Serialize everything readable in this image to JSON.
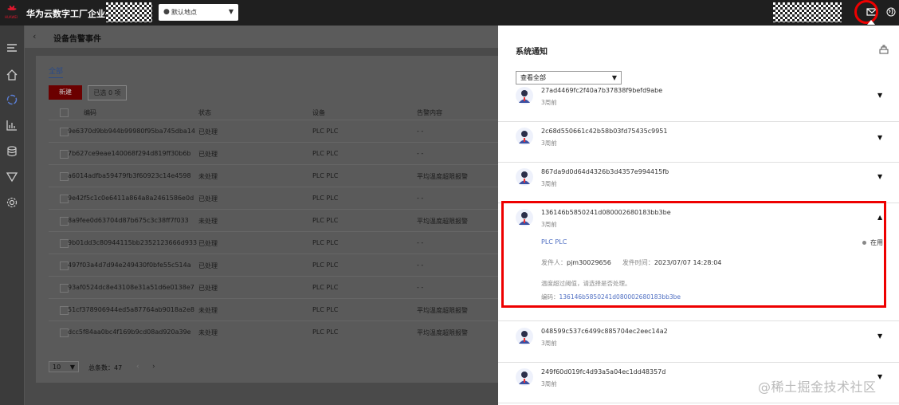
{
  "app": {
    "brand_word": "HUAWEI",
    "title": "华为云数字工厂企业平台",
    "location": "默认地点"
  },
  "colors": {
    "accent": "#4e6ec2",
    "brand": "#e4182f",
    "highlight": "#e00000"
  },
  "icons": {
    "sidebar": [
      "menu-icon",
      "home-icon",
      "refresh-cycle-icon",
      "bar-chart-icon",
      "database-icon",
      "funnel-icon",
      "gear-icon"
    ],
    "topbar": [
      "mail-icon",
      "globe-icon"
    ]
  },
  "page": {
    "back_label": "‹",
    "title": "设备告警事件",
    "tab_all": "全部",
    "new_button": "新建",
    "selected_label": "已选 0 项",
    "columns": [
      "编码",
      "状态",
      "设备",
      "告警内容"
    ],
    "rows": [
      {
        "code": "9e6370d9bb944b99980f95ba745dba14",
        "status": "已处理",
        "device": "PLC PLC",
        "content": "- -"
      },
      {
        "code": "7b627ce9eae140068f294d819ff30b6b",
        "status": "已处理",
        "device": "PLC PLC",
        "content": "- -"
      },
      {
        "code": "a6014adfba59479fb3f60923c14e4598",
        "status": "未处理",
        "device": "PLC PLC",
        "content": "平均温度超限报警"
      },
      {
        "code": "9e42f5c1c0e6411a864a8a2461586e0d",
        "status": "已处理",
        "device": "PLC PLC",
        "content": "- -"
      },
      {
        "code": "8a9fee0d63704d87b675c3c38ff7f033",
        "status": "未处理",
        "device": "PLC PLC",
        "content": "平均温度超限报警"
      },
      {
        "code": "9b01dd3c80944115bb2352123666d933",
        "status": "已处理",
        "device": "PLC PLC",
        "content": "- -"
      },
      {
        "code": "497f03a4d7d94e249430f0bfe55c514a",
        "status": "已处理",
        "device": "PLC PLC",
        "content": "- -"
      },
      {
        "code": "93af0524dc8e43108e31a51d6e0138e7",
        "status": "已处理",
        "device": "PLC PLC",
        "content": "- -"
      },
      {
        "code": "51cf378906944ed5a87764ab9018a2e8",
        "status": "未处理",
        "device": "PLC PLC",
        "content": "平均温度超限报警"
      },
      {
        "code": "dcc5f84aa0bc4f169b9cd08ad920a39e",
        "status": "未处理",
        "device": "PLC PLC",
        "content": "平均温度超限报警"
      }
    ],
    "page_size": "10",
    "total": "总条数：47",
    "prev": "‹",
    "next": "›"
  },
  "panel": {
    "title": "系统通知",
    "filter": "查看全部",
    "notifications": [
      {
        "id": "27ad4469fc2f40a7b37838f9befd9abe",
        "time": "3周前",
        "chevron": "▼"
      },
      {
        "id": "2c68d550661c42b58b03fd75435c9951",
        "time": "3周前",
        "chevron": "▼"
      },
      {
        "id": "867da9d0d64d4326b3d4357e994415fb",
        "time": "3周前",
        "chevron": "▼"
      },
      {
        "id": "136146b5850241d080002680183bb3be",
        "time": "3周前",
        "chevron": "▲"
      },
      {
        "id": "048599c537c6499c885704ec2eec14a2",
        "time": "3周前",
        "chevron": "▼"
      },
      {
        "id": "249f60d019fc4d93a5a04ec1dd48357d",
        "time": "3周前",
        "chevron": "▼"
      }
    ],
    "detail": {
      "device": "PLC PLC",
      "status": "在用",
      "sender_label": "发件人：",
      "sender": "pjm30029656",
      "sent_label": "发件时间：",
      "sent_time": "2023/07/07 14:28:04",
      "message": "温度超过阈值，请选择是否处理。",
      "code_label": "编码：",
      "code": "136146b5850241d080002680183bb3be"
    }
  },
  "watermark": "@稀土掘金技术社区"
}
